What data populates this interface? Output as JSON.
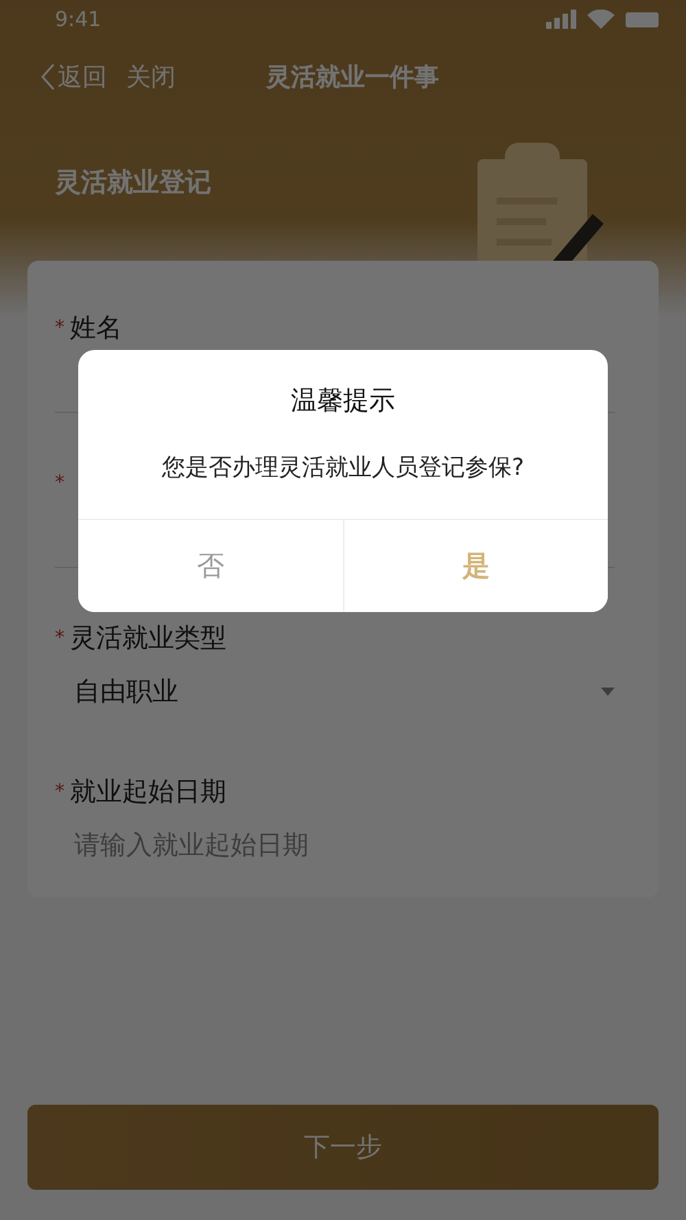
{
  "status_bar": {
    "time": "9:41"
  },
  "nav": {
    "back": "返回",
    "close": "关闭",
    "title": "灵活就业一件事"
  },
  "header": {
    "title": "灵活就业登记"
  },
  "form": {
    "fields": [
      {
        "kind": "text",
        "required": true,
        "required_mark": "*",
        "label": "姓名"
      },
      {
        "kind": "text",
        "required": true,
        "required_mark": "*"
      },
      {
        "kind": "select",
        "required": true,
        "required_mark": "*",
        "label": "灵活就业类型",
        "value": "自由职业"
      },
      {
        "kind": "date",
        "required": true,
        "required_mark": "*",
        "label": "就业起始日期",
        "placeholder": "请输入就业起始日期"
      }
    ]
  },
  "next_button": {
    "label": "下一步"
  },
  "dialog": {
    "title": "温馨提示",
    "message": "您是否办理灵活就业人员登记参保?",
    "buttons": [
      {
        "label": "否",
        "primary": false
      },
      {
        "label": "是",
        "primary": true
      }
    ]
  }
}
